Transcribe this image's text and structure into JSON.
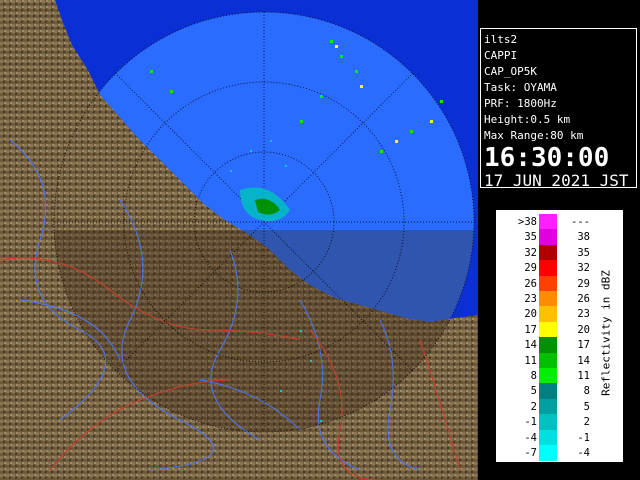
{
  "info": {
    "lines": [
      "ilts2",
      "CAPPI",
      "CAP_OP5K",
      "Task: OYAMA",
      "PRF: 1800Hz",
      "Height:0.5 km",
      "Max Range:80 km"
    ],
    "time": "16:30:00",
    "date": "17 JUN 2021 JST"
  },
  "legend": {
    "unit_label": "Reflectivity in dBZ",
    "rows": [
      {
        "low": ">38",
        "high": "---",
        "color": "#ff1fff"
      },
      {
        "low": "35",
        "high": "38",
        "color": "#e000e0"
      },
      {
        "low": "32",
        "high": "35",
        "color": "#b00000"
      },
      {
        "low": "29",
        "high": "32",
        "color": "#ff0000"
      },
      {
        "low": "26",
        "high": "29",
        "color": "#ff4000"
      },
      {
        "low": "23",
        "high": "26",
        "color": "#ff8c00"
      },
      {
        "low": "20",
        "high": "23",
        "color": "#ffc000"
      },
      {
        "low": "17",
        "high": "20",
        "color": "#ffff00"
      },
      {
        "low": "14",
        "high": "17",
        "color": "#009000"
      },
      {
        "low": "11",
        "high": "14",
        "color": "#00c000"
      },
      {
        "low": "8",
        "high": "11",
        "color": "#00f000"
      },
      {
        "low": "5",
        "high": "8",
        "color": "#008080"
      },
      {
        "low": "2",
        "high": "5",
        "color": "#00a0a0"
      },
      {
        "low": "-1",
        "high": "2",
        "color": "#00c0c0"
      },
      {
        "low": "-4",
        "high": "-1",
        "color": "#00e0e0"
      },
      {
        "low": "-7",
        "high": "-4",
        "color": "#00ffff"
      }
    ]
  },
  "map": {
    "sea_color": "#2a68ff",
    "range_color": "#0a32d0",
    "land_color": "#6e5a3c"
  }
}
